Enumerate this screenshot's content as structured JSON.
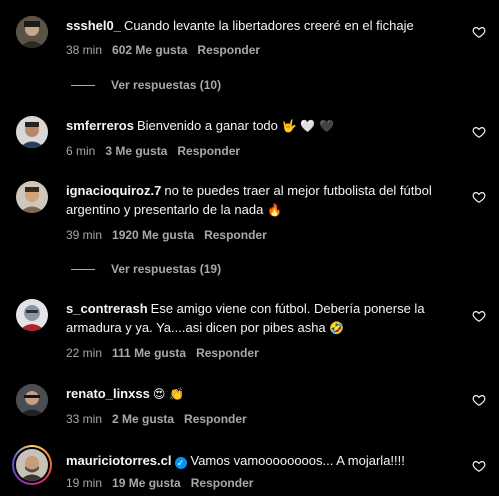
{
  "comments": [
    {
      "username": "ssshel0_",
      "text": "Cuando levante la libertadores creeré en el fichaje",
      "time": "38 min",
      "likes": "602 Me gusta",
      "reply_label": "Responder",
      "view_replies": "Ver respuestas (10)"
    },
    {
      "username": "smferreros",
      "text": "Bienvenido a ganar todo",
      "emojis": "🤟 🤍 🖤",
      "time": "6 min",
      "likes": "3 Me gusta",
      "reply_label": "Responder"
    },
    {
      "username": "ignacioquiroz.7",
      "text": "no te puedes traer al mejor futbolista del fútbol argentino y presentarlo de la nada",
      "emojis": "🔥",
      "time": "39 min",
      "likes": "1920 Me gusta",
      "reply_label": "Responder",
      "view_replies": "Ver respuestas (19)"
    },
    {
      "username": "s_contrerash",
      "text": "Ese amigo viene con fútbol. Debería ponerse la armadura y ya. Ya....asi dicen por pibes asha",
      "emojis": "🤣",
      "time": "22 min",
      "likes": "111 Me gusta",
      "reply_label": "Responder"
    },
    {
      "username": "renato_linxss",
      "text": "",
      "emojis": "😍 👏",
      "time": "33 min",
      "likes": "2 Me gusta",
      "reply_label": "Responder"
    },
    {
      "username": "mauriciotorres.cl",
      "verified": true,
      "text": "Vamos vamoooooooos... A mojarla!!!!",
      "time": "19 min",
      "likes": "19 Me gusta",
      "reply_label": "Responder"
    }
  ],
  "icons": {
    "like": "heart-outline-icon",
    "verified": "verified-badge-icon"
  },
  "colors": {
    "background": "#000000",
    "text": "#f5f5f5",
    "muted": "#a8a8a8",
    "verified": "#0095f6"
  }
}
